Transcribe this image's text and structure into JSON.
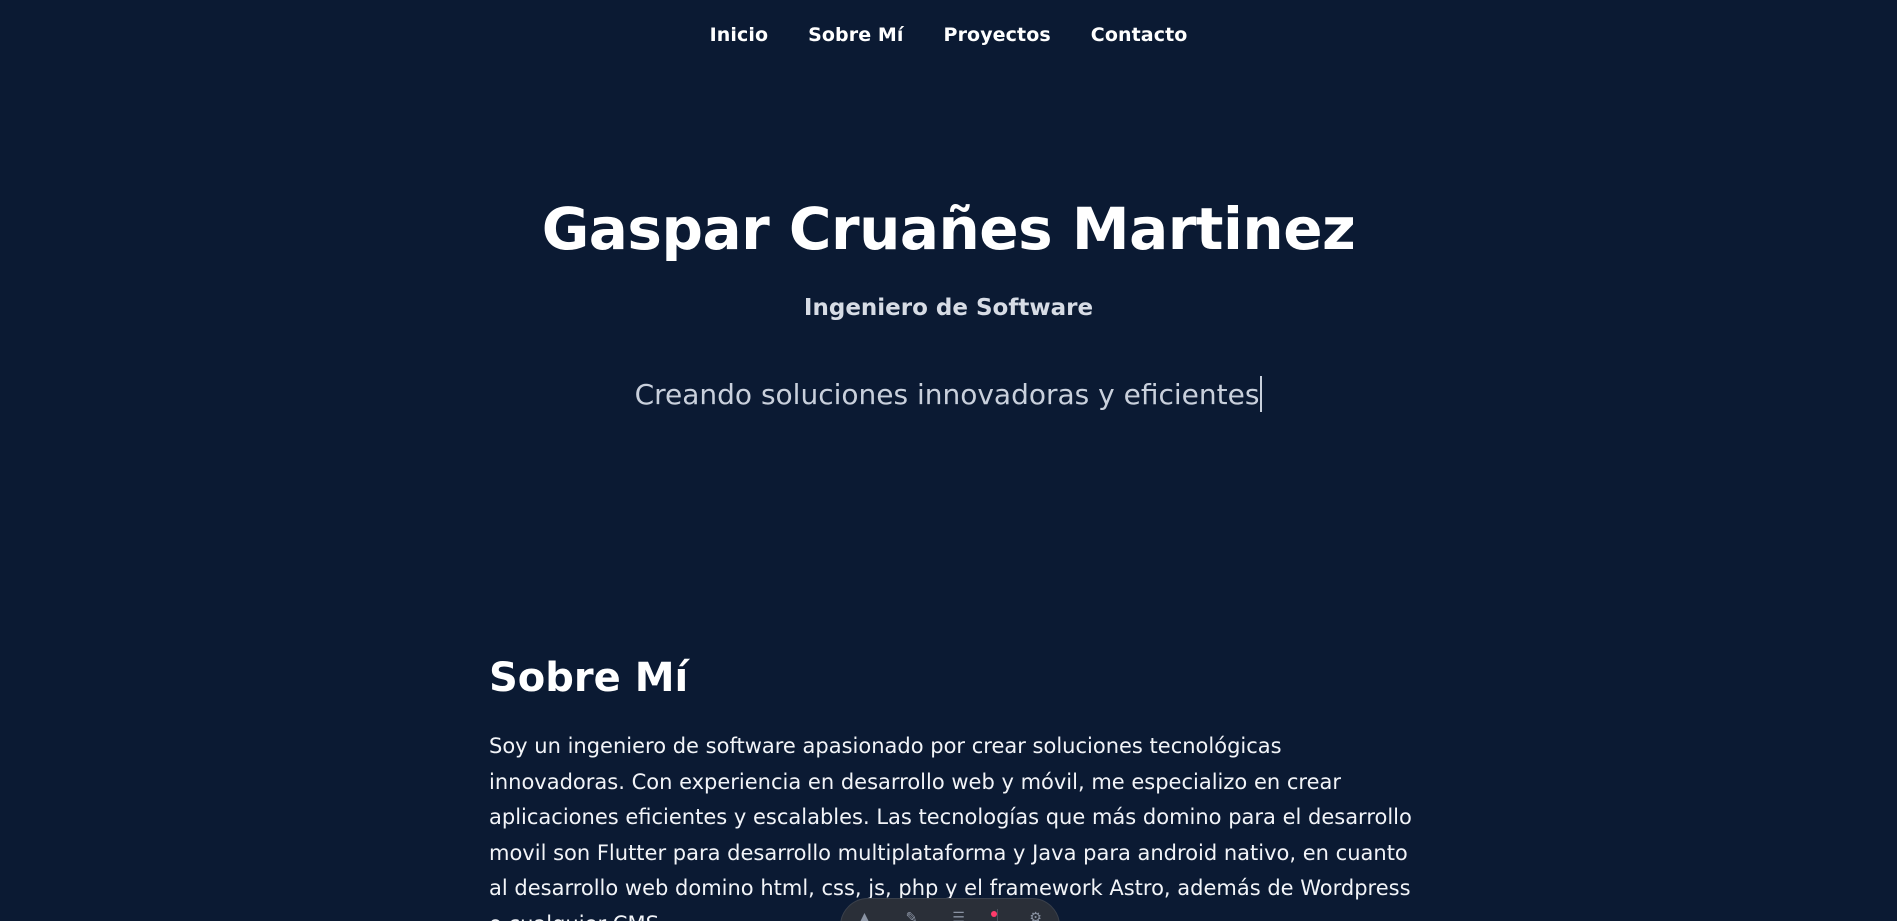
{
  "nav": {
    "items": [
      {
        "label": "Inicio"
      },
      {
        "label": "Sobre Mí"
      },
      {
        "label": "Proyectos"
      },
      {
        "label": "Contacto"
      }
    ]
  },
  "hero": {
    "name": "Gaspar Cruañes Martinez",
    "role": "Ingeniero de Software",
    "tagline": "Creando soluciones innovadoras y eficientes"
  },
  "about": {
    "title": "Sobre Mí",
    "text": "Soy un ingeniero de software apasionado por crear soluciones tecnológicas innovadoras. Con experiencia en desarrollo web y móvil, me especializo en crear aplicaciones eficientes y escalables. Las tecnologías que más domino para el desarrollo movil son Flutter para desarrollo multiplataforma y Java para android nativo, en cuanto al desarrollo web domino html, css, js, php y el framework Astro, además de Wordpress o cualquier CMS"
  },
  "toolbar": {
    "icons": [
      "pointer-icon",
      "pen-icon",
      "menu-icon",
      "settings-icon"
    ]
  },
  "colors": {
    "background": "#0b1a33",
    "text": "#ffffff",
    "muted": "#c9d0dc"
  }
}
